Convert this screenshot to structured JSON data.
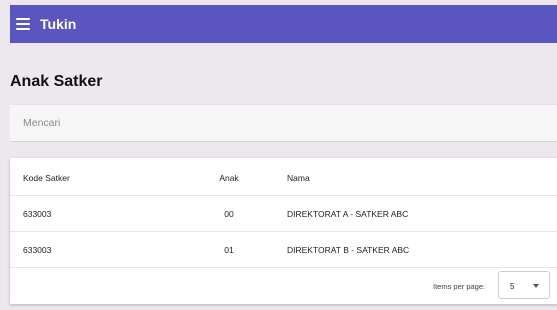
{
  "app": {
    "title": "Tukin",
    "menu_icon": "hamburger-menu-icon",
    "toolbar_color": "#5b55bf"
  },
  "page": {
    "title": "Anak Satker"
  },
  "search": {
    "placeholder": "Mencari",
    "value": ""
  },
  "table": {
    "columns": {
      "kode": "Kode Satker",
      "anak": "Anak",
      "nama": "Nama"
    },
    "rows": [
      {
        "kode": "633003",
        "anak": "00",
        "nama": "DIREKTORAT A - SATKER ABC"
      },
      {
        "kode": "633003",
        "anak": "01",
        "nama": "DIREKTORAT B - SATKER ABC"
      }
    ]
  },
  "paginator": {
    "items_per_page_label": "Items per page:",
    "page_size": "5"
  }
}
